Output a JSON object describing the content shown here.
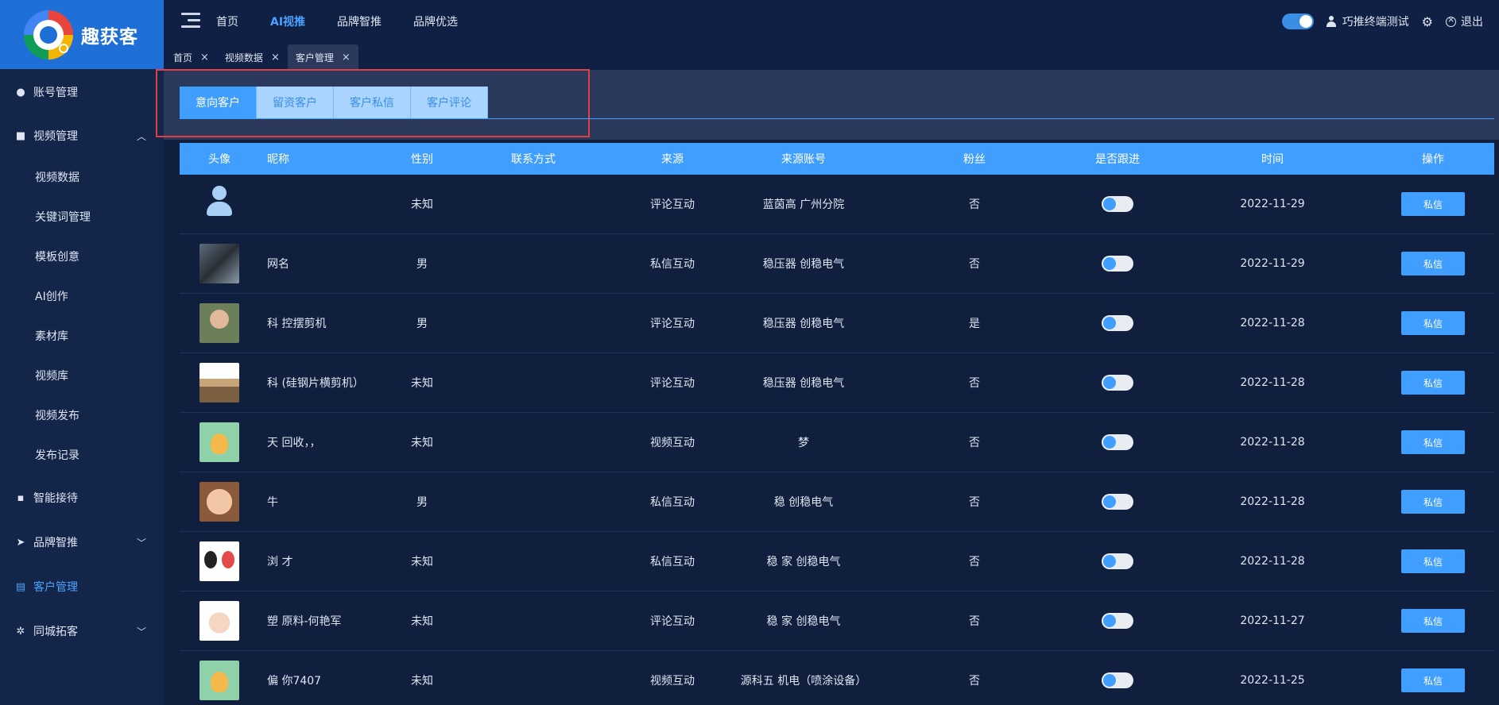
{
  "brand": {
    "name": "趣获客"
  },
  "topnav": {
    "items": [
      {
        "label": "首页",
        "active": false
      },
      {
        "label": "AI视推",
        "active": true
      },
      {
        "label": "品牌智推",
        "active": false
      },
      {
        "label": "品牌优选",
        "active": false
      }
    ],
    "user": "巧推终端测试",
    "logout": "退出"
  },
  "tags": [
    {
      "label": "首页",
      "active": false
    },
    {
      "label": "视频数据",
      "active": false
    },
    {
      "label": "客户管理",
      "active": true
    }
  ],
  "sidebar": {
    "items": [
      {
        "label": "账号管理",
        "icon": "user-icon"
      },
      {
        "label": "视频管理",
        "icon": "camera-icon",
        "expanded": true
      },
      {
        "label": "视频数据"
      },
      {
        "label": "关键词管理"
      },
      {
        "label": "模板创意"
      },
      {
        "label": "AI创作"
      },
      {
        "label": "素材库"
      },
      {
        "label": "视频库"
      },
      {
        "label": "视频发布"
      },
      {
        "label": "发布记录"
      },
      {
        "label": "智能接待",
        "icon": "chat-icon"
      },
      {
        "label": "品牌智推",
        "icon": "send-icon"
      },
      {
        "label": "客户管理",
        "icon": "clipboard-icon",
        "active": true
      },
      {
        "label": "同城拓客",
        "icon": "aperture-icon"
      }
    ]
  },
  "tabs": [
    {
      "label": "意向客户",
      "active": true
    },
    {
      "label": "留资客户",
      "active": false
    },
    {
      "label": "客户私信",
      "active": false
    },
    {
      "label": "客户评论",
      "active": false
    }
  ],
  "table": {
    "headers": [
      "头像",
      "昵称",
      "性别",
      "联系方式",
      "来源",
      "来源账号",
      "粉丝",
      "是否跟进",
      "时间",
      "操作"
    ],
    "rows": [
      {
        "avatar": "default-avatar",
        "nickname": "",
        "gender": "未知",
        "contact": "",
        "source": "评论互动",
        "account": "蓝茵高 广州分院",
        "fans": "否",
        "time": "2022-11-29",
        "action": "私信"
      },
      {
        "avatar": "photo-1",
        "nickname": "网名",
        "gender": "男",
        "contact": "",
        "source": "私信互动",
        "account": "稳压器 创稳电气",
        "fans": "否",
        "time": "2022-11-29",
        "action": "私信"
      },
      {
        "avatar": "photo-2",
        "nickname": "科 控摆剪机",
        "gender": "男",
        "contact": "",
        "source": "评论互动",
        "account": "稳压器 创稳电气",
        "fans": "是",
        "time": "2022-11-28",
        "action": "私信"
      },
      {
        "avatar": "photo-3",
        "nickname": "科 (硅钢片横剪机）",
        "gender": "未知",
        "contact": "",
        "source": "评论互动",
        "account": "稳压器 创稳电气",
        "fans": "否",
        "time": "2022-11-28",
        "action": "私信"
      },
      {
        "avatar": "photo-4",
        "nickname": "天 回收，，",
        "gender": "未知",
        "contact": "",
        "source": "视频互动",
        "account": "梦",
        "fans": "否",
        "time": "2022-11-28",
        "action": "私信"
      },
      {
        "avatar": "photo-5",
        "nickname": "牛",
        "gender": "男",
        "contact": "",
        "source": "私信互动",
        "account": "稳 创稳电气",
        "fans": "否",
        "time": "2022-11-28",
        "action": "私信"
      },
      {
        "avatar": "photo-6",
        "nickname": "浏 才",
        "gender": "未知",
        "contact": "",
        "source": "私信互动",
        "account": "稳 家 创稳电气",
        "fans": "否",
        "time": "2022-11-28",
        "action": "私信"
      },
      {
        "avatar": "photo-7",
        "nickname": "塑 原料-何艳军",
        "gender": "未知",
        "contact": "",
        "source": "评论互动",
        "account": "稳 家 创稳电气",
        "fans": "否",
        "time": "2022-11-27",
        "action": "私信"
      },
      {
        "avatar": "photo-4",
        "nickname": "偏 你7407",
        "gender": "未知",
        "contact": "",
        "source": "视频互动",
        "account": "源科五 机电（喷涂设备）",
        "fans": "否",
        "time": "2022-11-25",
        "action": "私信"
      }
    ]
  },
  "colors": {
    "accent": "#409eff",
    "highlight": "#e24040"
  }
}
